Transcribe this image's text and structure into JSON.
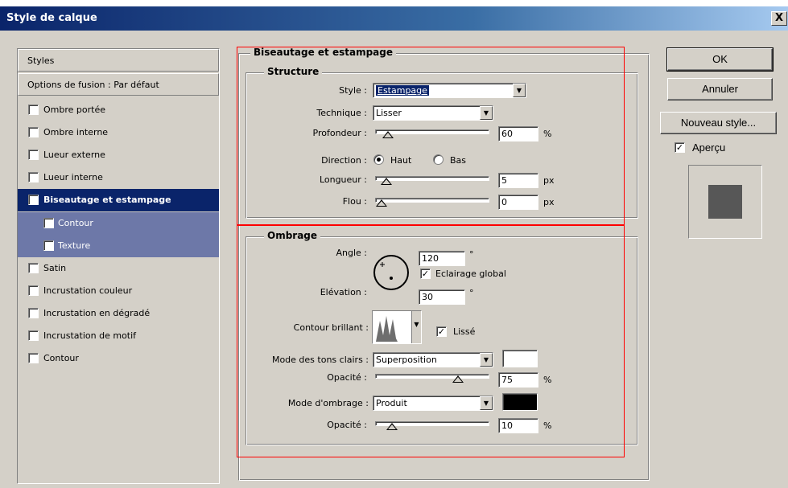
{
  "window": {
    "title": "Style de calque",
    "close_glyph": "X"
  },
  "left_list": {
    "header": "Styles",
    "blend_options": "Options de fusion : Par défaut",
    "items": [
      {
        "label": "Ombre portée",
        "checked": false
      },
      {
        "label": "Ombre interne",
        "checked": false
      },
      {
        "label": "Lueur externe",
        "checked": false
      },
      {
        "label": "Lueur interne",
        "checked": false
      },
      {
        "label": "Biseautage et estampage",
        "checked": true,
        "selected": true
      },
      {
        "label": "Contour",
        "checked": false,
        "sub": true
      },
      {
        "label": "Texture",
        "checked": false,
        "sub": true
      },
      {
        "label": "Satin",
        "checked": false
      },
      {
        "label": "Incrustation couleur",
        "checked": false
      },
      {
        "label": "Incrustation en dégradé",
        "checked": false
      },
      {
        "label": "Incrustation de motif",
        "checked": false
      },
      {
        "label": "Contour",
        "checked": false
      }
    ]
  },
  "bevel": {
    "title": "Biseautage et estampage",
    "structure": {
      "title": "Structure",
      "style_label": "Style :",
      "style_value": "Estampage",
      "technique_label": "Technique :",
      "technique_value": "Lisser",
      "depth_label": "Profondeur :",
      "depth_value": "60",
      "depth_unit": "%",
      "depth_fraction": 0.06,
      "direction_label": "Direction :",
      "direction_up": "Haut",
      "direction_down": "Bas",
      "size_label": "Longueur :",
      "size_value": "5",
      "size_unit": "px",
      "size_fraction": 0.05,
      "soften_label": "Flou :",
      "soften_value": "0",
      "soften_unit": "px",
      "soften_fraction": 0.0
    },
    "shading": {
      "title": "Ombrage",
      "angle_label": "Angle :",
      "angle_value": "120",
      "angle_unit": "°",
      "global_light_label": "Eclairage global",
      "global_light_checked": true,
      "altitude_label": "Elévation :",
      "altitude_value": "30",
      "altitude_unit": "°",
      "gloss_label": "Contour brillant :",
      "antialias_label": "Lissé",
      "antialias_checked": true,
      "highlight_mode_label": "Mode des tons clairs :",
      "highlight_mode_value": "Superposition",
      "highlight_color": "#ffffff",
      "highlight_opacity_label": "Opacité :",
      "highlight_opacity_value": "75",
      "highlight_opacity_unit": "%",
      "highlight_opacity_fraction": 0.75,
      "shadow_mode_label": "Mode d'ombrage :",
      "shadow_mode_value": "Produit",
      "shadow_color": "#000000",
      "shadow_opacity_label": "Opacité :",
      "shadow_opacity_value": "10",
      "shadow_opacity_unit": "%",
      "shadow_opacity_fraction": 0.1
    }
  },
  "buttons": {
    "ok": "OK",
    "cancel": "Annuler",
    "new_style": "Nouveau style...",
    "preview": "Aperçu",
    "preview_checked": true
  },
  "colors": {
    "title_bar_start": "#0a246a",
    "title_bar_end": "#a6caf0",
    "highlight_outline": "#ff0000",
    "preview_swatch": "#575757"
  }
}
